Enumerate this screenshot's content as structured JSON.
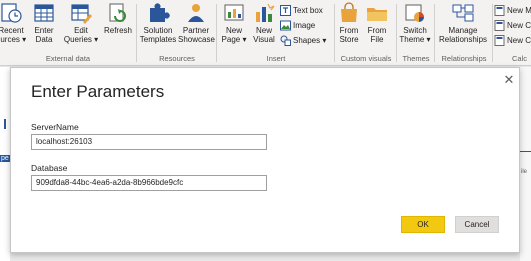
{
  "ribbon": {
    "buttons": [
      {
        "line1": "Recent",
        "line2": "ources ▾"
      },
      {
        "line1": "Enter",
        "line2": "Data"
      },
      {
        "line1": "Edit",
        "line2": "Queries ▾"
      },
      {
        "line1": "Refresh",
        "line2": ""
      },
      {
        "line1": "Solution",
        "line2": "Templates"
      },
      {
        "line1": "Partner",
        "line2": "Showcase"
      },
      {
        "line1": "New",
        "line2": "Page ▾"
      },
      {
        "line1": "New",
        "line2": "Visual"
      },
      {
        "line1": "From",
        "line2": "Store"
      },
      {
        "line1": "From",
        "line2": "File"
      },
      {
        "line1": "Switch",
        "line2": "Theme ▾"
      },
      {
        "line1": "Manage",
        "line2": "Relationships"
      }
    ],
    "small_buttons": {
      "text_box": "Text box",
      "image": "Image",
      "shapes": "Shapes ▾",
      "new_m": "New M",
      "new_c1": "New C",
      "new_c2": "New C"
    },
    "groups": {
      "external_data": "External data",
      "resources": "Resources",
      "insert": "Insert",
      "custom_visuals": "Custom visuals",
      "themes": "Themes",
      "relationships": "Relationships",
      "calc": "Calc"
    }
  },
  "dialog": {
    "title": "Enter Parameters",
    "close_glyph": "✕",
    "fields": [
      {
        "label": "ServerName",
        "value": "localhost:26103"
      },
      {
        "label": "Database",
        "value": "909dfda8-44bc-4ea6-a2da-8b966bde9cfc"
      }
    ],
    "ok_label": "OK",
    "cancel_label": "Cancel"
  },
  "background": {
    "left_fragment": "pe",
    "right_fragment": "ile"
  },
  "colors": {
    "accent_yellow": "#f2c811",
    "ribbon_bg": "#f3f2f1",
    "icon_blue": "#2b579a",
    "icon_orange": "#e8a33d"
  }
}
